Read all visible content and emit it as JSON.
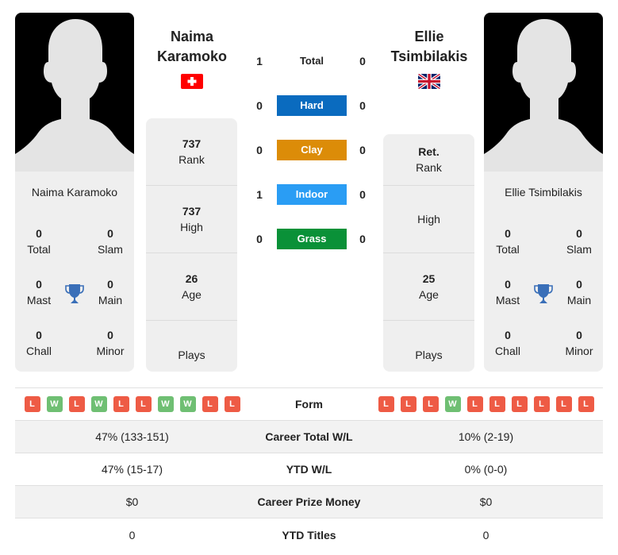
{
  "players": {
    "left": {
      "name": "Naima Karamoko",
      "name_line1": "Naima",
      "name_line2": "Karamoko",
      "flag": "switzerland-flag",
      "titles": {
        "total": "0",
        "total_label": "Total",
        "slam": "0",
        "slam_label": "Slam",
        "mast": "0",
        "mast_label": "Mast",
        "main": "0",
        "main_label": "Main",
        "chall": "0",
        "chall_label": "Chall",
        "minor": "0",
        "minor_label": "Minor"
      },
      "stats": [
        {
          "value": "737",
          "label": "Rank"
        },
        {
          "value": "737",
          "label": "High"
        },
        {
          "value": "26",
          "label": "Age"
        },
        {
          "value": "",
          "label": "Plays"
        }
      ]
    },
    "right": {
      "name": "Ellie Tsimbilakis",
      "name_line1": "Ellie",
      "name_line2": "Tsimbilakis",
      "flag": "united-kingdom-flag",
      "titles": {
        "total": "0",
        "total_label": "Total",
        "slam": "0",
        "slam_label": "Slam",
        "mast": "0",
        "mast_label": "Mast",
        "main": "0",
        "main_label": "Main",
        "chall": "0",
        "chall_label": "Chall",
        "minor": "0",
        "minor_label": "Minor"
      },
      "stats": [
        {
          "value": "Ret.",
          "label": "Rank"
        },
        {
          "value": "",
          "label": "High"
        },
        {
          "value": "25",
          "label": "Age"
        },
        {
          "value": "",
          "label": "Plays"
        }
      ]
    }
  },
  "h2h": {
    "total": {
      "label": "Total",
      "left": "1",
      "right": "0"
    },
    "surfaces": [
      {
        "label": "Hard",
        "left": "0",
        "right": "0",
        "color": "#0a6bbf"
      },
      {
        "label": "Clay",
        "left": "0",
        "right": "0",
        "color": "#dc8c08"
      },
      {
        "label": "Indoor",
        "left": "1",
        "right": "0",
        "color": "#2a9df4"
      },
      {
        "label": "Grass",
        "left": "0",
        "right": "0",
        "color": "#0a9138"
      }
    ]
  },
  "comparison": {
    "form_label": "Form",
    "form_left": [
      "L",
      "W",
      "L",
      "W",
      "L",
      "L",
      "W",
      "W",
      "L",
      "L"
    ],
    "form_right": [
      "L",
      "L",
      "L",
      "W",
      "L",
      "L",
      "L",
      "L",
      "L",
      "L"
    ],
    "rows": [
      {
        "label": "Career Total W/L",
        "left": "47% (133-151)",
        "right": "10% (2-19)"
      },
      {
        "label": "YTD W/L",
        "left": "47% (15-17)",
        "right": "0% (0-0)"
      },
      {
        "label": "Career Prize Money",
        "left": "$0",
        "right": "$0"
      },
      {
        "label": "YTD Titles",
        "left": "0",
        "right": "0"
      }
    ]
  },
  "colors": {
    "loss": "#ee5b45",
    "win": "#6fbf73",
    "trophy": "#3a6fb8"
  }
}
